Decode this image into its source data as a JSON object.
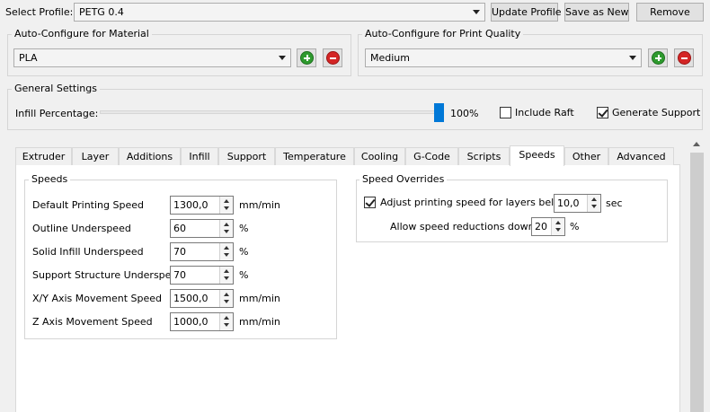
{
  "profile": {
    "label": "Select Profile:",
    "value": "PETG 0.4",
    "update_label": "Update Profile",
    "save_as_new_label": "Save as New",
    "remove_label": "Remove"
  },
  "material": {
    "title": "Auto-Configure for Material",
    "value": "PLA"
  },
  "quality": {
    "title": "Auto-Configure for Print Quality",
    "value": "Medium"
  },
  "general": {
    "title": "General Settings",
    "infill_label": "Infill Percentage:",
    "infill_value": "100%",
    "infill_fraction": 1.0,
    "raft_label": "Include Raft",
    "raft_checked": false,
    "support_label": "Generate Support",
    "support_checked": true
  },
  "tabs": [
    {
      "label": "Extruder"
    },
    {
      "label": "Layer"
    },
    {
      "label": "Additions"
    },
    {
      "label": "Infill"
    },
    {
      "label": "Support"
    },
    {
      "label": "Temperature"
    },
    {
      "label": "Cooling"
    },
    {
      "label": "G-Code"
    },
    {
      "label": "Scripts"
    },
    {
      "label": "Speeds",
      "active": true
    },
    {
      "label": "Other"
    },
    {
      "label": "Advanced"
    }
  ],
  "speeds": {
    "title": "Speeds",
    "rows": [
      {
        "label": "Default Printing Speed",
        "value": "1300,0",
        "unit": "mm/min"
      },
      {
        "label": "Outline Underspeed",
        "value": "60",
        "unit": "%"
      },
      {
        "label": "Solid Infill Underspeed",
        "value": "70",
        "unit": "%"
      },
      {
        "label": "Support Structure Underspeed",
        "value": "70",
        "unit": "%"
      },
      {
        "label": "X/Y Axis Movement Speed",
        "value": "1500,0",
        "unit": "mm/min"
      },
      {
        "label": "Z Axis Movement Speed",
        "value": "1000,0",
        "unit": "mm/min"
      }
    ]
  },
  "overrides": {
    "title": "Speed Overrides",
    "adjust_label": "Adjust printing speed for layers below",
    "adjust_checked": true,
    "adjust_value": "10,0",
    "adjust_unit": "sec",
    "reduction_label": "Allow speed reductions down to",
    "reduction_value": "20",
    "reduction_unit": "%"
  }
}
